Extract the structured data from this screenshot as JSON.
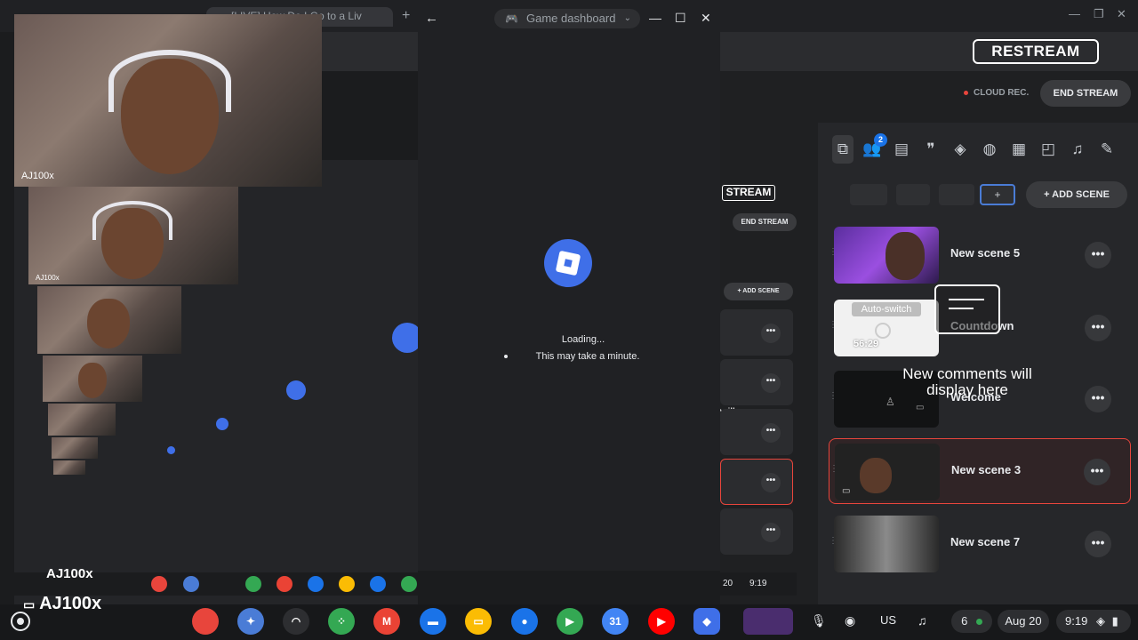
{
  "browser": {
    "active_tab_title": "[LIVE] How Do I Go to a Liv",
    "new_tab_icon": "plus-icon"
  },
  "restream": {
    "logo": "RESTREAM",
    "cloud_rec": "CLOUD REC.",
    "end_stream": "END STREAM",
    "add_scene": "+ ADD SCENE",
    "notification_count": "2",
    "scenes": [
      {
        "name": "New scene 5"
      },
      {
        "name": "Countdown",
        "badge": "Auto-switch",
        "timer": "56:29"
      },
      {
        "name": "Welcome"
      },
      {
        "name": "New scene 3",
        "selected": true
      },
      {
        "name": "New scene 7"
      }
    ],
    "more_label": "•••",
    "comments_overlay": "New comments will display here"
  },
  "game_dashboard": {
    "title": "Game dashboard",
    "loading": "Loading...",
    "subtitle": "This may take a minute."
  },
  "webcam": {
    "label": "AJ100x"
  },
  "nested": {
    "logo": "STREAM",
    "end_stream": "END STREAM",
    "add_scene": "+ ADD SCENE",
    "will": "will",
    "label_small": "AJ100x",
    "time": "9:19",
    "date_short": "20"
  },
  "shelf": {
    "label": "AJ100x",
    "date": "Aug 20",
    "time": "9:19",
    "ime": "US",
    "notification_count": "6",
    "apps": [
      {
        "name": "chrome",
        "color": "#e8453c"
      },
      {
        "name": "gemini",
        "color": "#4a7cd6"
      },
      {
        "name": "podcasts",
        "color": "#2d2e31"
      },
      {
        "name": "apps",
        "color": "#34a853"
      },
      {
        "name": "gmail",
        "color": "#ea4335"
      },
      {
        "name": "files",
        "color": "#1a73e8"
      },
      {
        "name": "slides",
        "color": "#fbbc04"
      },
      {
        "name": "messages",
        "color": "#1a73e8"
      },
      {
        "name": "play",
        "color": "#34a853"
      },
      {
        "name": "calendar",
        "color": "#4285f4"
      },
      {
        "name": "youtube",
        "color": "#ff0000"
      },
      {
        "name": "roblox",
        "color": "#3f6fe8"
      }
    ],
    "calendar_day": "31"
  }
}
